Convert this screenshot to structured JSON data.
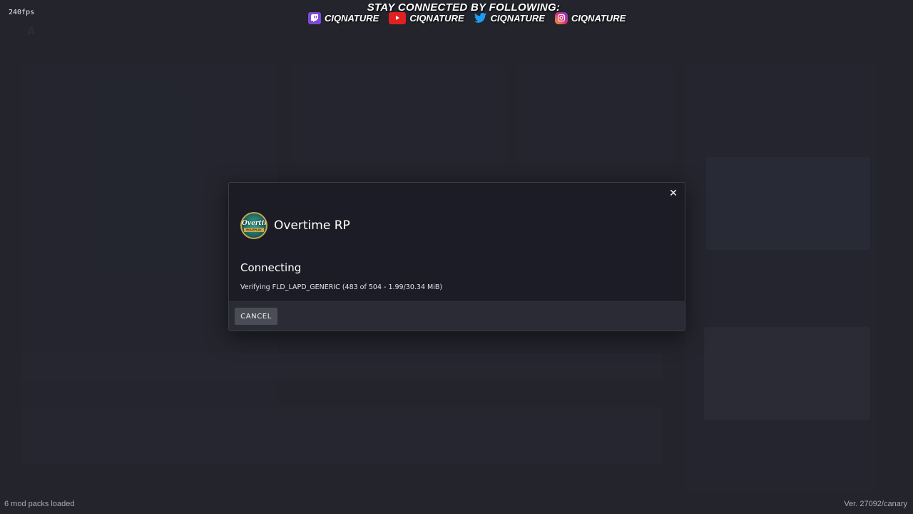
{
  "overlay": {
    "fps": "240fps",
    "stream_title": "STAY CONNECTED BY FOLLOWING:",
    "socials": [
      {
        "icon": "twitch-icon",
        "handle": "CIQNATURE",
        "color": "#7d4ad8"
      },
      {
        "icon": "youtube-icon",
        "handle": "CIQNATURE",
        "color": "#e22020"
      },
      {
        "icon": "twitter-icon",
        "handle": "CIQNATURE",
        "color": "#1d9bf0"
      },
      {
        "icon": "instagram-icon",
        "handle": "CIQNATURE",
        "color": "#d6307a"
      }
    ]
  },
  "modal": {
    "server_name": "Overtime RP",
    "server_logo": {
      "text": "Overtime",
      "subtext": "ROLEPLAY"
    },
    "status_title": "Connecting",
    "status_detail": "Verifying FLD_LAPD_GENERIC (483 of 504 - 1.99/30.34 MiB)",
    "cancel_label": "CANCEL",
    "close_icon": "close-icon"
  },
  "footer": {
    "mod_packs": "6 mod packs loaded",
    "version": "Ver. 27092/canary"
  },
  "colors": {
    "background": "#2a2c36",
    "modal_bg": "#1b1c26",
    "footer_bg": "#2a2b34",
    "button_bg": "#4b4d56"
  }
}
